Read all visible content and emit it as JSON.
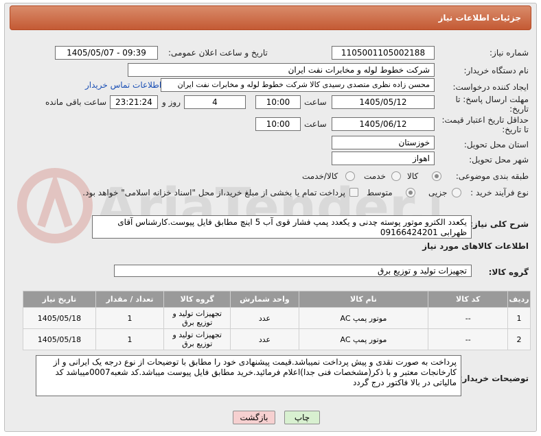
{
  "header": {
    "title": "جزئیات اطلاعات نیاز"
  },
  "form": {
    "need_number_label": "شماره نیاز:",
    "need_number": "1105001105002188",
    "announce_label": "تاریخ و ساعت اعلان عمومی:",
    "announce_value": "1405/05/07 - 09:39",
    "buyer_org_label": "نام دستگاه خریدار:",
    "buyer_org": "شرکت خطوط لوله و مخابرات نفت ایران",
    "requester_label": "ایجاد کننده درخواست:",
    "requester": "محسن زاده نظری متصدی رسیدی کالا شرکت خطوط لوله و مخابرات نفت ایران",
    "contact_link": "اطلاعات تماس خریدار",
    "deadline_label_1": "مهلت ارسال پاسخ: تا",
    "deadline_label_2": "تاریخ:",
    "deadline_date": "1405/05/12",
    "time_label": "ساعت",
    "deadline_time": "10:00",
    "days_value": "4",
    "days_label": "روز و",
    "remaining_time": "23:21:24",
    "remaining_label": "ساعت باقی مانده",
    "validity_label_1": "حداقل تاریخ اعتبار قیمت:",
    "validity_label_2": "تا تاریخ:",
    "validity_date": "1405/06/12",
    "validity_time": "10:00",
    "province_label": "استان محل تحویل:",
    "province": "خوزستان",
    "city_label": "شهر محل تحویل:",
    "city": "اهواز",
    "category_label": "طبقه بندی موضوعی:",
    "category_options": [
      "کالا",
      "خدمت",
      "کالا/خدمت"
    ],
    "process_label": "نوع فرآیند خرید :",
    "process_options": [
      "جزیی",
      "متوسط"
    ],
    "payment_note": "پرداخت تمام یا بخشی از مبلغ خرید،از محل \"اسناد خزانه اسلامی\" خواهد بود.",
    "general_desc_label": "شرح کلی نیاز:",
    "general_desc": "یکعدد الکترو موتور پوسته چدنی و یکعدد پمپ فشار قوی آب 5 اینچ مطابق فایل پیوست.کارشناس آقای ظهرابی 09166424201",
    "goods_info_label": "اطلاعات کالاهای مورد نیاز",
    "goods_group_label": "گروه کالا:",
    "goods_group": "تجهیزات تولید و توزیع برق"
  },
  "table": {
    "headers": [
      "ردیف",
      "کد کالا",
      "نام کالا",
      "واحد شمارش",
      "گروه کالا",
      "تعداد / مقدار",
      "تاریخ نیاز"
    ],
    "rows": [
      [
        "1",
        "--",
        "موتور پمپ AC",
        "عدد",
        "تجهیزات تولید و توزیع برق",
        "1",
        "1405/05/18"
      ],
      [
        "2",
        "--",
        "موتور پمپ AC",
        "عدد",
        "تجهیزات تولید و توزیع برق",
        "1",
        "1405/05/18"
      ]
    ]
  },
  "buyer_notes_label": "توضیحات خریدار:",
  "buyer_notes": "پرداخت به صورت نقدی و پیش پرداخت نمیباشد.قیمت پیشنهادی خود را مطابق با توضیحات از نوع درجه یک ایرانی و از کارخانجات معتبر و با ذکر(مشخصات فنی جدا)اعلام فرمائید.خرید مطابق فایل پیوست میباشد.کد شعبه0007میباشد کد مالیاتی در بالا فاکتور درج گردد",
  "buttons": {
    "print": "چاپ",
    "back": "بازگشت"
  },
  "watermark_text": "AriaTender.neT",
  "colors": {
    "header": "#c45a34",
    "table_header": "#9a9a9a",
    "link": "#1a4fb5",
    "back_button": "#f6d0d0",
    "print_button": "#d8f0d0"
  }
}
